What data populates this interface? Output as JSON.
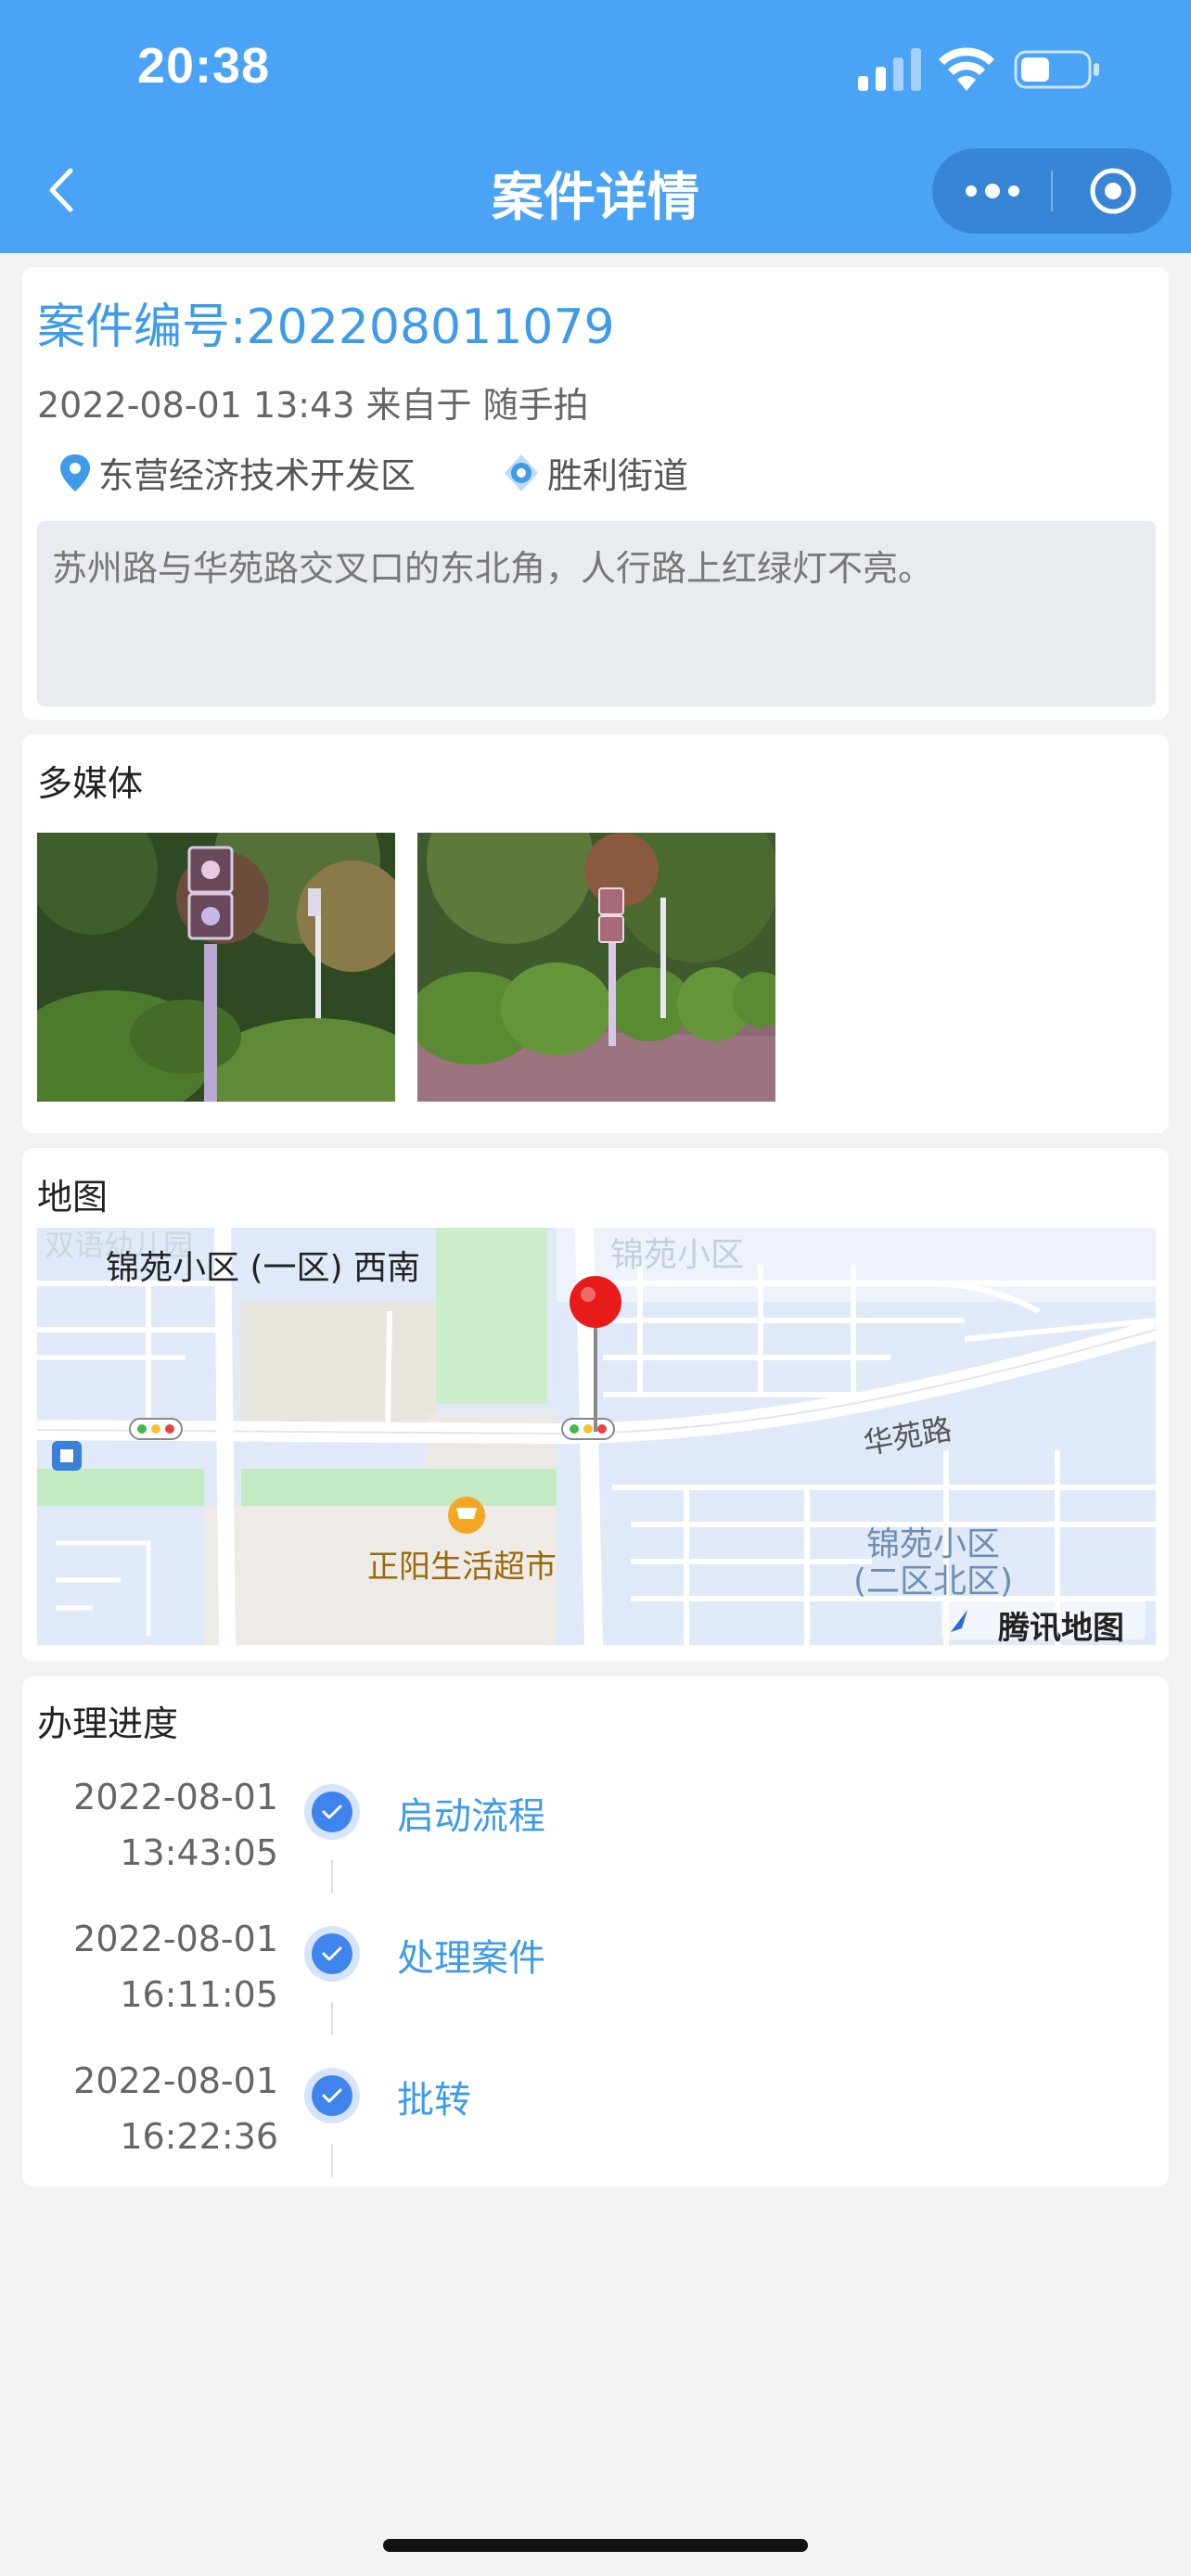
{
  "status_bar": {
    "time": "20:38"
  },
  "nav": {
    "title": "案件详情"
  },
  "case": {
    "number": "案件编号:202208011079",
    "meta": "2022-08-01 13:43 来自于 随手拍",
    "district": "东营经济技术开发区",
    "street": "胜利街道",
    "description": "苏州路与华苑路交叉口的东北角，人行路上红绿灯不亮。"
  },
  "media": {
    "title": "多媒体"
  },
  "map": {
    "title": "地图",
    "labels": {
      "top_left_faded": "双语幼儿园",
      "area_1": "锦苑小区 (一区) 西南",
      "area_top": "锦苑小区",
      "road": "华苑路",
      "supermarket": "正阳生活超市",
      "area_2_line1": "锦苑小区",
      "area_2_line2": "(二区北区)",
      "brand": "腾讯地图"
    }
  },
  "progress": {
    "title": "办理进度",
    "steps": [
      {
        "date": "2022-08-01",
        "time": "13:43:05",
        "label": "启动流程"
      },
      {
        "date": "2022-08-01",
        "time": "16:11:05",
        "label": "处理案件"
      },
      {
        "date": "2022-08-01",
        "time": "16:22:36",
        "label": "批转"
      }
    ]
  }
}
